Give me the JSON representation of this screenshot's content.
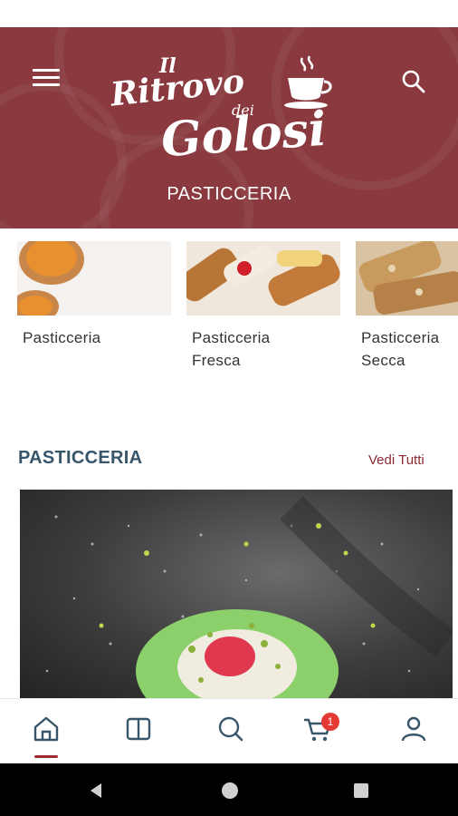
{
  "header": {
    "logo_line1": "Il",
    "logo_line2": "Ritrovo",
    "logo_line3": "dei",
    "logo_line4": "Golosi",
    "subtitle": "PASTICCERIA",
    "brand_color": "#8a3a3f",
    "menu_icon": "menu-icon",
    "search_icon": "search-icon"
  },
  "categories": [
    {
      "line1": "Pasticceria",
      "line2": ""
    },
    {
      "line1": "Pasticceria",
      "line2": "Fresca"
    },
    {
      "line1": "Pasticceria",
      "line2": "Secca"
    }
  ],
  "section": {
    "title": "PASTICCERIA",
    "see_all": "Vedi Tutti"
  },
  "bottom_nav": {
    "items": [
      "home-icon",
      "catalog-icon",
      "search-icon",
      "cart-icon",
      "account-icon"
    ],
    "active": "home-icon",
    "cart_badge": "1",
    "accent": "#9c2a33"
  },
  "system_nav": [
    "back-icon",
    "home-circle-icon",
    "recents-icon"
  ]
}
